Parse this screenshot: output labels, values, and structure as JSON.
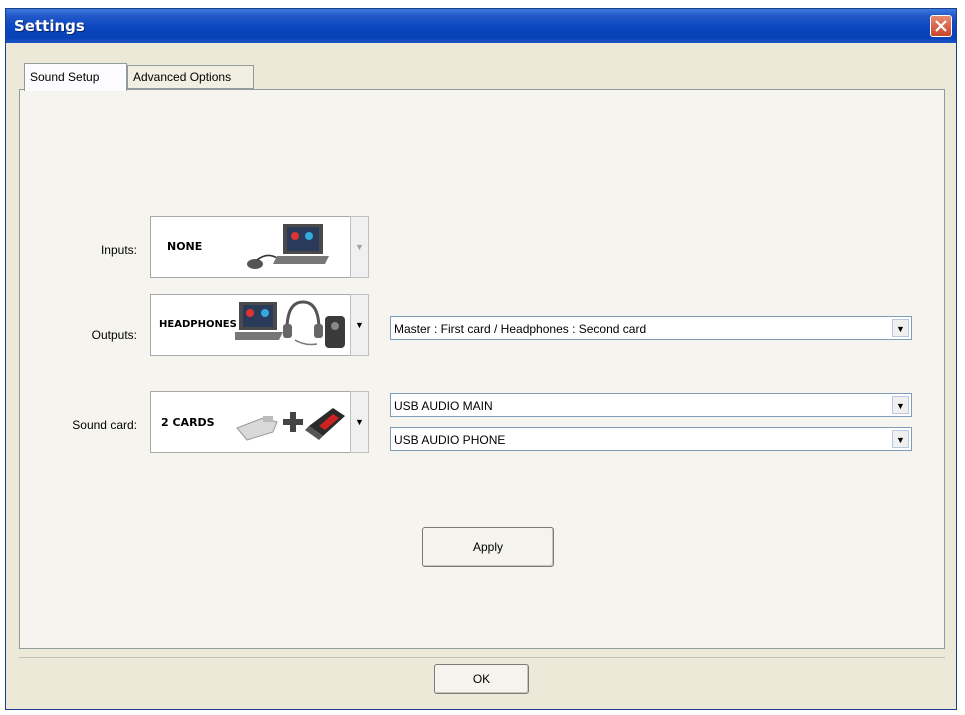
{
  "window": {
    "title": "Settings"
  },
  "tabs": [
    {
      "label": "Sound Setup",
      "active": true
    },
    {
      "label": "Advanced Options",
      "active": false
    }
  ],
  "inputs": {
    "label": "Inputs:",
    "image_text": "NONE",
    "image_icon": "laptop-mouse-icon"
  },
  "outputs": {
    "label": "Outputs:",
    "image_text": "HEADPHONES",
    "image_icon": "laptop-headphones-speaker-icon",
    "routing_value": "Master : First card / Headphones : Second card"
  },
  "sound_card": {
    "label": "Sound card:",
    "image_text": "2 CARDS",
    "image_icon": "usb-cards-icon",
    "card1_value": "USB AUDIO MAIN",
    "card2_value": "USB AUDIO PHONE"
  },
  "buttons": {
    "apply": "Apply",
    "ok": "OK"
  },
  "colors": {
    "titlebar": "#0a46c0",
    "close_button": "#c8432a",
    "dialog_bg": "#ece9d8"
  }
}
